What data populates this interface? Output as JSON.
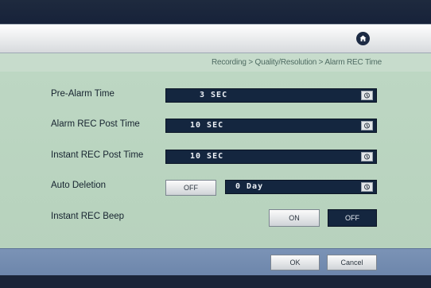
{
  "breadcrumb": "Recording > Quality/Resolution > Alarm REC Time",
  "settings": {
    "pre_alarm_time": {
      "label": "Pre-Alarm Time",
      "value": "3 SEC"
    },
    "alarm_rec_post_time": {
      "label": "Alarm REC Post Time",
      "value": "10 SEC"
    },
    "instant_rec_post_time": {
      "label": "Instant REC Post Time",
      "value": "10 SEC"
    },
    "auto_deletion": {
      "label": "Auto Deletion",
      "toggle": "OFF",
      "value": "0 Day"
    },
    "instant_rec_beep": {
      "label": "Instant REC Beep",
      "on_label": "ON",
      "off_label": "OFF",
      "selected": "OFF"
    }
  },
  "footer": {
    "ok_label": "OK",
    "cancel_label": "Cancel"
  },
  "icons": {
    "home": "home-icon",
    "spin": "dial-icon"
  },
  "colors": {
    "accent_dark": "#14263f",
    "panel_green": "#bdd7c3",
    "footer_blue": "#7b93b6"
  }
}
